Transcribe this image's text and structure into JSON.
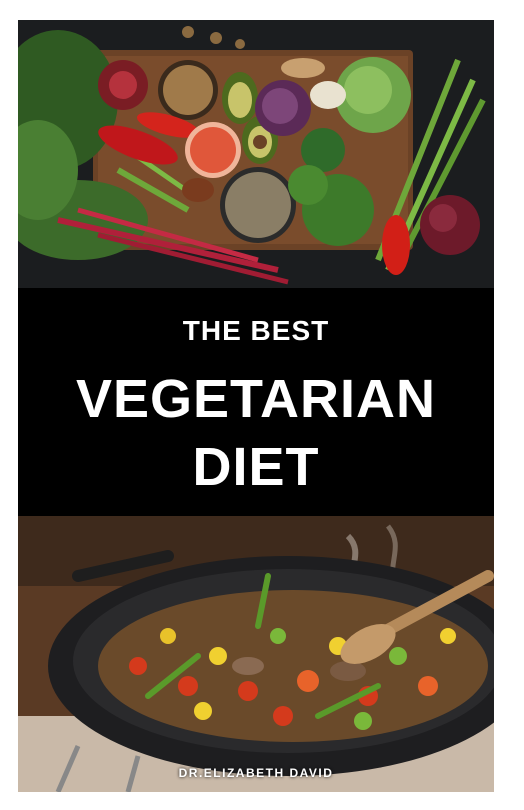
{
  "cover": {
    "title_small": "THE BEST",
    "title_large_line1": "VEGETARIAN",
    "title_large_line2": "DIET",
    "author": "DR.ELIZABETH DAVID"
  },
  "colors": {
    "background": "#000000",
    "text": "#ffffff"
  }
}
